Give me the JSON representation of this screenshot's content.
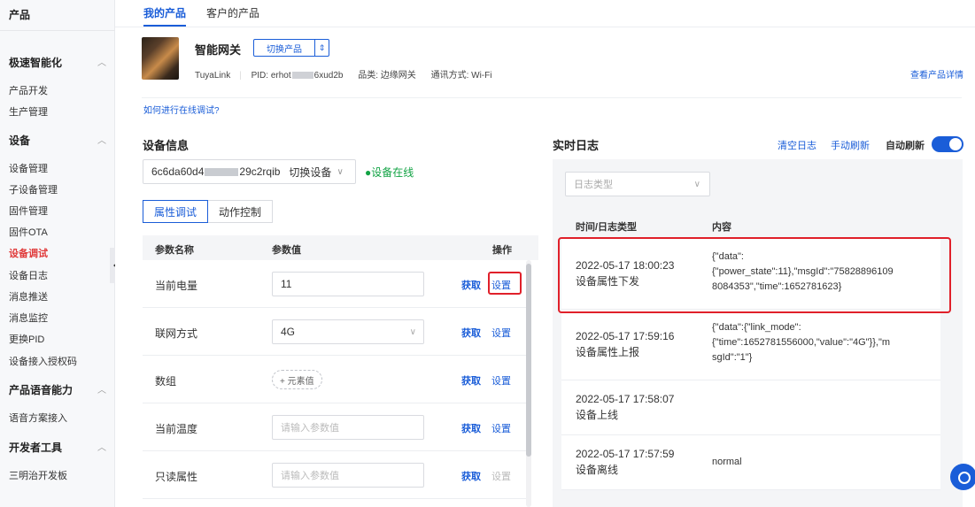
{
  "sidebar": {
    "title": "产品",
    "groups": [
      {
        "label": "极速智能化",
        "items": [
          "产品开发",
          "生产管理"
        ]
      },
      {
        "label": "设备",
        "items": [
          "设备管理",
          "子设备管理",
          "固件管理",
          "固件OTA",
          "设备调试",
          "设备日志",
          "消息推送",
          "消息监控",
          "更换PID",
          "设备接入授权码"
        ]
      },
      {
        "label": "产品语音能力",
        "items": [
          "语音方案接入"
        ]
      },
      {
        "label": "开发者工具",
        "items": [
          "三明治开发板"
        ]
      }
    ],
    "active_item": "设备调试"
  },
  "tabs": [
    "我的产品",
    "客户的产品"
  ],
  "product": {
    "name": "智能网关",
    "switch_label": "切换产品",
    "brand": "TuyaLink",
    "pid_prefix": "PID: erhot",
    "pid_suffix": "6xud2b",
    "category": "品类: 边缘网关",
    "comm": "通讯方式: Wi-Fi",
    "detail_link": "查看产品详情"
  },
  "howto_link": "如何进行在线调试?",
  "device_info": {
    "title": "设备信息",
    "device_id_prefix": "6c6da60d4",
    "device_id_suffix": "29c2rqib",
    "switch_device": "切换设备",
    "status": "●设备在线"
  },
  "subtabs": [
    "属性调试",
    "动作控制"
  ],
  "param_table": {
    "headers": {
      "name": "参数名称",
      "value": "参数值",
      "action": "操作"
    },
    "get_label": "获取",
    "set_label": "设置",
    "rows": [
      {
        "name": "当前电量",
        "value": "11"
      },
      {
        "name": "联网方式",
        "value": "4G"
      },
      {
        "name": "数组",
        "value": "+ 元素值"
      },
      {
        "name": "当前温度",
        "placeholder": "请输入参数值"
      },
      {
        "name": "只读属性",
        "placeholder": "请输入参数值"
      }
    ]
  },
  "realtime_log": {
    "title": "实时日志",
    "clear": "清空日志",
    "manual_refresh": "手动刷新",
    "auto_refresh": "自动刷新",
    "auto_refresh_on": true,
    "type_placeholder": "日志类型",
    "headers": {
      "time": "时间/日志类型",
      "content": "内容"
    },
    "rows": [
      {
        "time": "2022-05-17 18:00:23",
        "type": "设备属性下发",
        "content": "{\"data\":\n{\"power_state\":11},\"msgId\":\"75828896109\n8084353\",\"time\":1652781623}"
      },
      {
        "time": "2022-05-17 17:59:16",
        "type": "设备属性上报",
        "content": "{\"data\":{\"link_mode\":\n{\"time\":1652781556000,\"value\":\"4G\"}},\"m\nsgId\":\"1\"}"
      },
      {
        "time": "2022-05-17 17:58:07",
        "type": "设备上线",
        "content": ""
      },
      {
        "time": "2022-05-17 17:57:59",
        "type": "设备离线",
        "content": "normal"
      }
    ]
  },
  "colors": {
    "accent": "#1a5dd8",
    "highlight": "#e0202a",
    "online": "#12a344",
    "sidebar_active": "#e03b3b"
  }
}
